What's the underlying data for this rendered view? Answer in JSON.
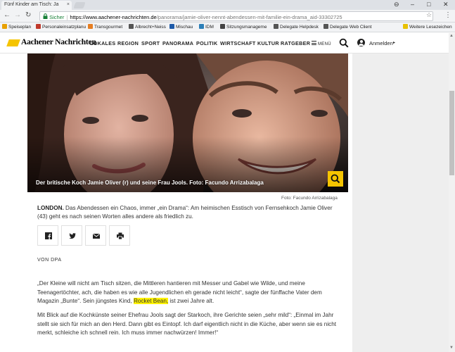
{
  "browser": {
    "tab_title": "Fünf Kinder am Tisch: Ja",
    "tab_close": "×",
    "win_user": "⊖",
    "win_min": "–",
    "win_max": "□",
    "win_close": "✕",
    "back": "←",
    "forward": "→",
    "reload": "↻",
    "secure_label": "Sicher",
    "url_host": "https://www.aachener-nachrichten.de",
    "url_path": "/panorama/jamie-oliver-nennt-abendessen-mit-familie-ein-drama_aid-33302725",
    "star": "☆",
    "menu": "⋮",
    "bookmarks": [
      {
        "label": "Speiseplan",
        "color": "#e8a000"
      },
      {
        "label": "Personaleinsatzplanu",
        "color": "#c0392b"
      },
      {
        "label": "Transgourmet",
        "color": "#e67e22"
      },
      {
        "label": "Albrecht+Neiss",
        "color": "#555555"
      },
      {
        "label": "Mischau",
        "color": "#1e5aa8"
      },
      {
        "label": "IDM",
        "color": "#2c7fb8"
      },
      {
        "label": "Sitzungsmanageme",
        "color": "#444444"
      },
      {
        "label": "Delegate Helpdesk",
        "color": "#555555"
      },
      {
        "label": "Delegate Web Client",
        "color": "#555555"
      }
    ],
    "more_bookmarks": "Weitere Lesezeichen"
  },
  "site": {
    "logo": "Aachener Nachrichten",
    "nav": [
      "LOKALES",
      "REGION",
      "SPORT",
      "PANORAMA",
      "POLITIK",
      "WIRTSCHAFT",
      "KULTUR",
      "RATGEBER"
    ],
    "menu_label": "MENÜ",
    "login_label": "Anmelden",
    "login_caret": "▸"
  },
  "article": {
    "caption": "Der britische Koch Jamie Oliver (r) und seine Frau Jools. Foto: Facundo Arrizabalaga",
    "credit": "Foto: Facundo Arrizabalaga",
    "dateline": "LONDON.",
    "lead": "Das Abendessen ein Chaos, immer „ein Drama“: Am heimischen Esstisch von Fernsehkoch Jamie Oliver (43) geht es nach seinen Worten alles andere als friedlich zu.",
    "byline": "VON DPA",
    "p1_before": "„Der Kleine will nicht am Tisch sitzen, die Mittleren hantieren mit Messer und Gabel wie Wilde, und meine Teenagertöchter, ach, die haben es wie alle Jugendlichen eh gerade nicht leicht“, sagte der fünffache Vater dem Magazin „Bunte“. Sein jüngstes Kind, ",
    "p1_highlight": "Rocket Bean,",
    "p1_after": " ist zwei Jahre alt.",
    "p2": "Mit Blick auf die Kochkünste seiner Ehefrau Jools sagt der Starkoch, ihre Gerichte seien „sehr mild“: „Einmal im Jahr stellt sie sich für mich an den Herd. Dann gibt es Eintopf. Ich darf eigentlich nicht in die Küche, aber wenn sie es nicht merkt, schleiche ich schnell rein. Ich muss immer nachwürzen! Immer!“"
  },
  "colors": {
    "accent_yellow": "#f5c400",
    "highlight": "#fff200"
  }
}
